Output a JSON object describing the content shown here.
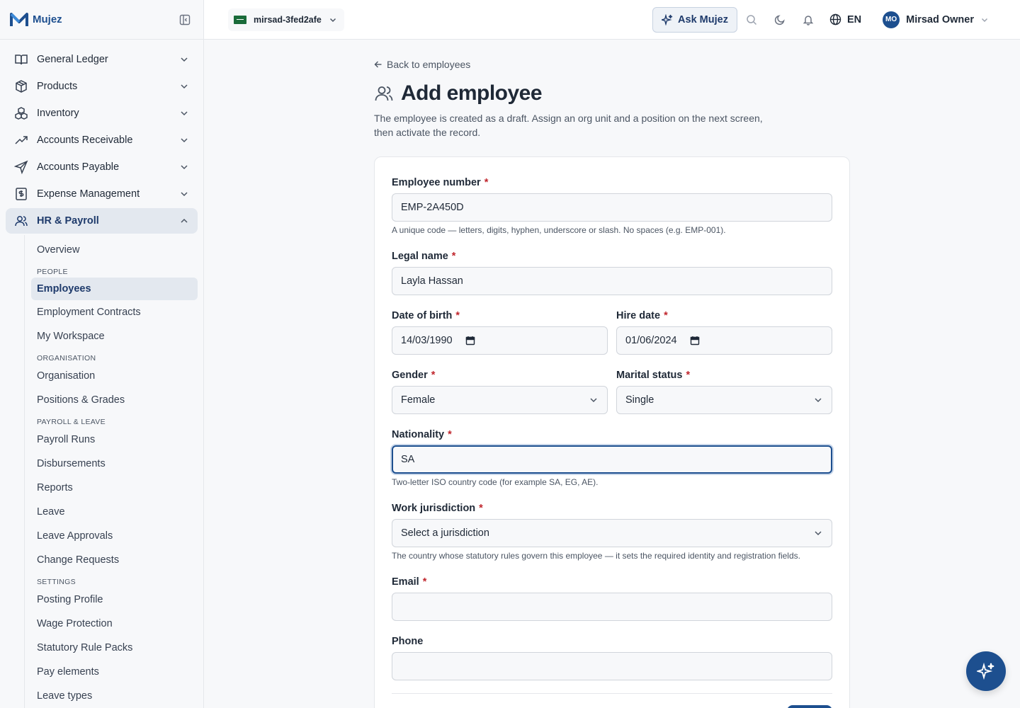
{
  "brand": {
    "name": "Mujez"
  },
  "sidebar": {
    "items": [
      {
        "label": "General Ledger"
      },
      {
        "label": "Products"
      },
      {
        "label": "Inventory"
      },
      {
        "label": "Accounts Receivable"
      },
      {
        "label": "Accounts Payable"
      },
      {
        "label": "Expense Management"
      },
      {
        "label": "HR & Payroll"
      }
    ],
    "hr_sub": {
      "overview": "Overview",
      "group_people": "PEOPLE",
      "employees": "Employees",
      "employment_contracts": "Employment Contracts",
      "my_workspace": "My Workspace",
      "group_organisation": "ORGANISATION",
      "organisation": "Organisation",
      "positions_grades": "Positions & Grades",
      "group_payroll_leave": "PAYROLL & LEAVE",
      "payroll_runs": "Payroll Runs",
      "disbursements": "Disbursements",
      "reports": "Reports",
      "leave": "Leave",
      "leave_approvals": "Leave Approvals",
      "change_requests": "Change Requests",
      "group_settings": "SETTINGS",
      "posting_profile": "Posting Profile",
      "wage_protection": "Wage Protection",
      "statutory_rule_packs": "Statutory Rule Packs",
      "pay_elements": "Pay elements",
      "leave_types": "Leave types"
    }
  },
  "topbar": {
    "org": "mirsad-3fed2afe",
    "ask": "Ask Mujez",
    "lang": "EN",
    "user_initials": "MO",
    "user_name": "Mirsad Owner"
  },
  "page": {
    "back": "Back to employees",
    "title": "Add employee",
    "intro": "The employee is created as a draft. Assign an org unit and a position on the next screen, then activate the record."
  },
  "form": {
    "required_mark": "*",
    "employee_number": {
      "label": "Employee number",
      "value": "EMP-2A450D",
      "hint": "A unique code — letters, digits, hyphen, underscore or slash. No spaces (e.g. EMP-001)."
    },
    "legal_name": {
      "label": "Legal name",
      "value": "Layla Hassan"
    },
    "dob": {
      "label": "Date of birth",
      "value": "14/03/1990"
    },
    "hire_date": {
      "label": "Hire date",
      "value": "01/06/2024"
    },
    "gender": {
      "label": "Gender",
      "value": "Female"
    },
    "marital": {
      "label": "Marital status",
      "value": "Single"
    },
    "nationality": {
      "label": "Nationality",
      "value": "SA",
      "hint": "Two-letter ISO country code (for example SA, EG, AE)."
    },
    "jurisdiction": {
      "label": "Work jurisdiction",
      "value": "Select a jurisdiction",
      "hint": "The country whose statutory rules govern this employee — it sets the required identity and registration fields."
    },
    "email": {
      "label": "Email",
      "value": ""
    },
    "phone": {
      "label": "Phone",
      "value": ""
    }
  }
}
